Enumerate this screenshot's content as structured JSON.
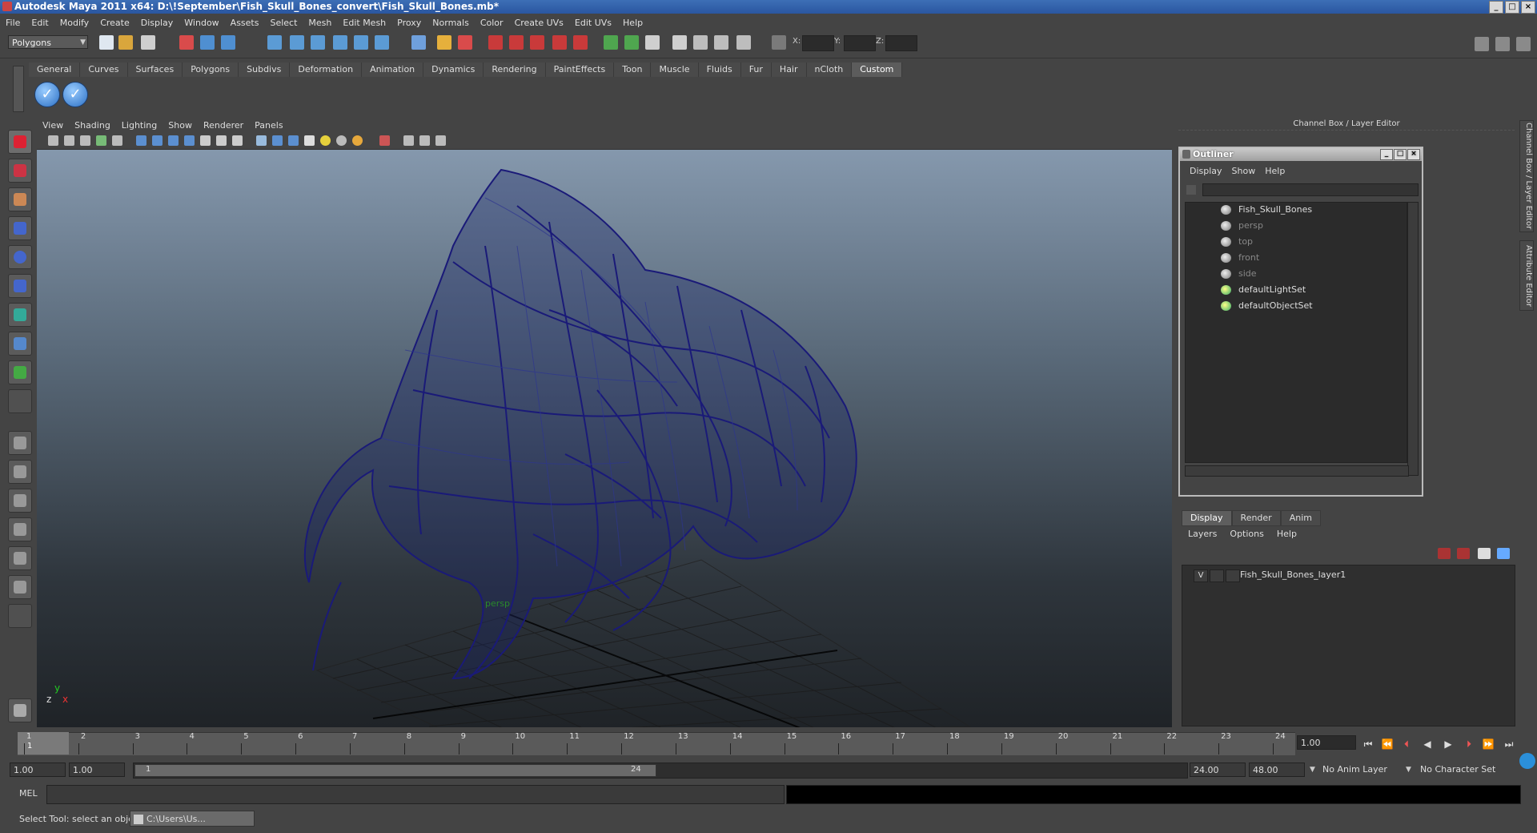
{
  "window": {
    "title": "Autodesk Maya 2011 x64: D:\\!September\\Fish_Skull_Bones_convert\\Fish_Skull_Bones.mb*"
  },
  "menubar": [
    "File",
    "Edit",
    "Modify",
    "Create",
    "Display",
    "Window",
    "Assets",
    "Select",
    "Mesh",
    "Edit Mesh",
    "Proxy",
    "Normals",
    "Color",
    "Create UVs",
    "Edit UVs",
    "Help"
  ],
  "statusline": {
    "menuset": "Polygons",
    "x_label": "X:",
    "y_label": "Y:",
    "z_label": "Z:"
  },
  "shelf": {
    "tabs": [
      "General",
      "Curves",
      "Surfaces",
      "Polygons",
      "Subdivs",
      "Deformation",
      "Animation",
      "Dynamics",
      "Rendering",
      "PaintEffects",
      "Toon",
      "Muscle",
      "Fluids",
      "Fur",
      "Hair",
      "nCloth",
      "Custom"
    ],
    "active": "Custom"
  },
  "viewport": {
    "menu": [
      "View",
      "Shading",
      "Lighting",
      "Show",
      "Renderer",
      "Panels"
    ],
    "camera_label": "persp",
    "axis_y": "y",
    "axis_x": "x",
    "axis_z": "z"
  },
  "rightpanel": {
    "header": "Channel Box / Layer Editor",
    "side_tabs": [
      "Channel Box / Layer Editor",
      "Attribute Editor"
    ]
  },
  "outliner": {
    "title": "Outliner",
    "menu": [
      "Display",
      "Show",
      "Help"
    ],
    "items": [
      {
        "name": "Fish_Skull_Bones",
        "dim": false
      },
      {
        "name": "persp",
        "dim": true
      },
      {
        "name": "top",
        "dim": true
      },
      {
        "name": "front",
        "dim": true
      },
      {
        "name": "side",
        "dim": true
      },
      {
        "name": "defaultLightSet",
        "dim": false
      },
      {
        "name": "defaultObjectSet",
        "dim": false
      }
    ]
  },
  "layereditor": {
    "tabs": [
      "Display",
      "Render",
      "Anim"
    ],
    "active": "Display",
    "menu": [
      "Layers",
      "Options",
      "Help"
    ],
    "layers": [
      {
        "visible": "V",
        "name": "Fish_Skull_Bones_layer1"
      }
    ]
  },
  "timeslider": {
    "ticks": [
      "1",
      "2",
      "3",
      "4",
      "5",
      "6",
      "7",
      "8",
      "9",
      "10",
      "11",
      "12",
      "13",
      "14",
      "15",
      "16",
      "17",
      "18",
      "19",
      "20",
      "21",
      "22",
      "23",
      "24"
    ],
    "current_frame": "1.00",
    "current_marker": "1"
  },
  "rangeslider": {
    "start": "1.00",
    "playback_start": "1.00",
    "range_start_label": "1",
    "range_end_label": "24",
    "playback_end": "24.00",
    "end": "48.00",
    "anim_layer": "No Anim Layer",
    "character_set": "No Character Set"
  },
  "commandline": {
    "label": "MEL"
  },
  "helpline": {
    "text": "Select Tool: select an object",
    "task": "C:\\Users\\Us..."
  }
}
